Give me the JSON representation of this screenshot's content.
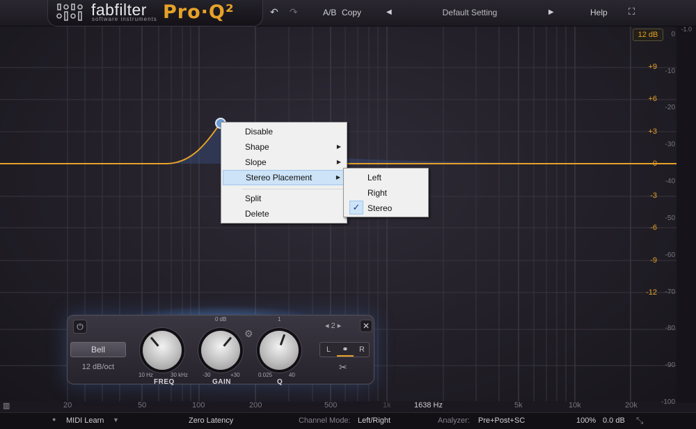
{
  "header": {
    "brand": "fabfilter",
    "brand_sub": "software instruments",
    "product": "Pro·Q²",
    "undo_icon": "undo-icon",
    "redo_icon": "redo-icon",
    "ab_label": "A/B",
    "copy_label": "Copy",
    "preset_name": "Default Setting",
    "help_label": "Help"
  },
  "graph": {
    "range_button": "12 dB",
    "db_scale": [
      "+9",
      "+6",
      "+3",
      "0",
      "-3",
      "-6",
      "-9",
      "-12"
    ],
    "analyzer_scale": [
      "0",
      "-10",
      "-20",
      "-30",
      "-40",
      "-50",
      "-60",
      "-70",
      "-80",
      "-90",
      "-100"
    ],
    "top_corner": "-1.0",
    "freq_labels": [
      "20",
      "50",
      "100",
      "200",
      "500",
      "1k",
      "1638 Hz",
      "5k",
      "10k",
      "20k"
    ],
    "curve_color": "#e6a229"
  },
  "context_menu": {
    "items": [
      "Disable",
      "Shape",
      "Slope",
      "Stereo Placement",
      "Split",
      "Delete"
    ],
    "highlighted": "Stereo Placement",
    "submenu": [
      "Left",
      "Right",
      "Stereo"
    ],
    "checked": "Stereo"
  },
  "band_panel": {
    "shape": "Bell",
    "slope": "12 dB/oct",
    "band_number": "2",
    "freq": {
      "min": "10 Hz",
      "max": "30 kHz",
      "name": "FREQ"
    },
    "gain": {
      "top": "0 dB",
      "min": "-30",
      "max": "+30",
      "name": "GAIN"
    },
    "q": {
      "top": "1",
      "min": "0.025",
      "max": "40",
      "name": "Q"
    },
    "stereo_buttons": [
      "L",
      "R"
    ]
  },
  "bottom_bar": {
    "midi": "MIDI Learn",
    "latency": "Zero Latency",
    "channel_mode_label": "Channel Mode:",
    "channel_mode": "Left/Right",
    "analyzer_label": "Analyzer:",
    "analyzer": "Pre+Post+SC",
    "zoom": "100%",
    "output_gain": "0.0 dB"
  }
}
